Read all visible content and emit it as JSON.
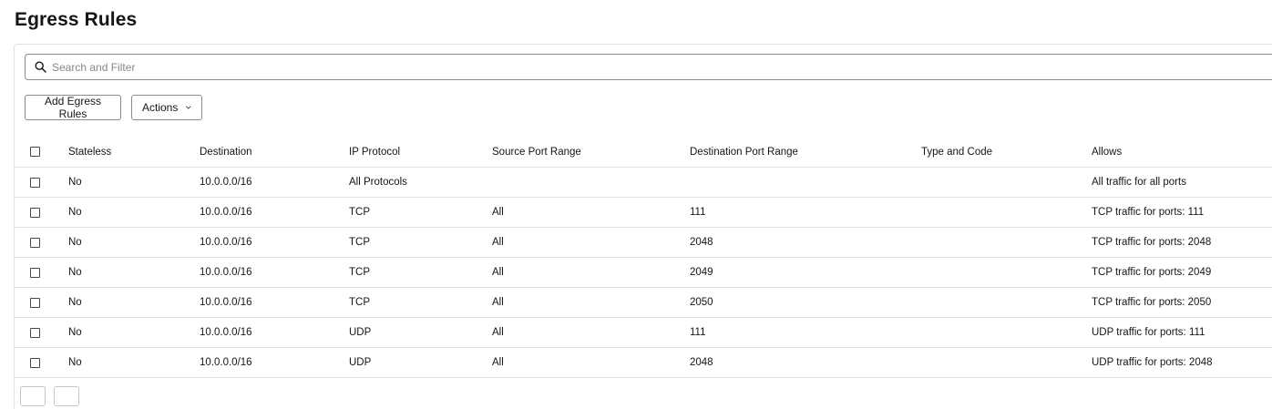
{
  "page": {
    "title": "Egress Rules"
  },
  "search": {
    "placeholder": "Search and Filter",
    "value": ""
  },
  "toolbar": {
    "add_label": "Add Egress Rules",
    "actions_label": "Actions"
  },
  "table": {
    "columns": [
      "Stateless",
      "Destination",
      "IP Protocol",
      "Source Port Range",
      "Destination Port Range",
      "Type and Code",
      "Allows"
    ],
    "rows": [
      {
        "stateless": "No",
        "destination": "10.0.0.0/16",
        "protocol": "All Protocols",
        "source_port": "",
        "dest_port": "",
        "type_code": "",
        "allows": "All traffic for all ports"
      },
      {
        "stateless": "No",
        "destination": "10.0.0.0/16",
        "protocol": "TCP",
        "source_port": "All",
        "dest_port": "111",
        "type_code": "",
        "allows": "TCP traffic for ports: 111"
      },
      {
        "stateless": "No",
        "destination": "10.0.0.0/16",
        "protocol": "TCP",
        "source_port": "All",
        "dest_port": "2048",
        "type_code": "",
        "allows": "TCP traffic for ports: 2048"
      },
      {
        "stateless": "No",
        "destination": "10.0.0.0/16",
        "protocol": "TCP",
        "source_port": "All",
        "dest_port": "2049",
        "type_code": "",
        "allows": "TCP traffic for ports: 2049"
      },
      {
        "stateless": "No",
        "destination": "10.0.0.0/16",
        "protocol": "TCP",
        "source_port": "All",
        "dest_port": "2050",
        "type_code": "",
        "allows": "TCP traffic for ports: 2050"
      },
      {
        "stateless": "No",
        "destination": "10.0.0.0/16",
        "protocol": "UDP",
        "source_port": "All",
        "dest_port": "111",
        "type_code": "",
        "allows": "UDP traffic for ports: 111"
      },
      {
        "stateless": "No",
        "destination": "10.0.0.0/16",
        "protocol": "UDP",
        "source_port": "All",
        "dest_port": "2048",
        "type_code": "",
        "allows": "UDP traffic for ports: 2048"
      }
    ]
  },
  "icons": {
    "search": "search-icon",
    "actions_dropdown": "chevron-down-icon"
  },
  "colors": {
    "text": "#161513",
    "border": "#8e8a86",
    "divider": "#e4e1dd",
    "placeholder": "#8b8783"
  }
}
